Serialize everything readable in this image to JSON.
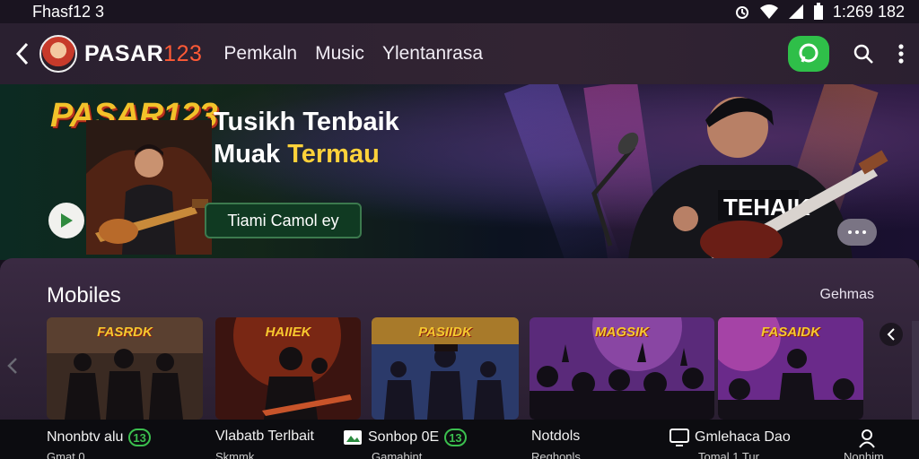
{
  "status_bar": {
    "left_text": "Fhasf12 3",
    "time": "1:269 182"
  },
  "app_bar": {
    "brand_text": "PASAR",
    "brand_number": "123",
    "nav": [
      "Pemkaln",
      "Music",
      "Ylentanrasa"
    ]
  },
  "hero": {
    "logo_text": "PASAR123",
    "heading_line1": "Tusikh Tenbaik",
    "heading_line2_plain": "Muak ",
    "heading_line2_accent": "Termau",
    "cta_label": "Tiami Camol ey",
    "shirt_text": "TEHAIK"
  },
  "section": {
    "title": "Mobiles",
    "see_all": "Gehmas",
    "cards": [
      {
        "label": "FASRDK",
        "bg": "#3a2a22"
      },
      {
        "label": "HAIIEK",
        "bg": "#3b1410"
      },
      {
        "label": "PASIIDK",
        "bg": "#2b3a6a"
      },
      {
        "label": "MAGSIK",
        "bg": "#5a2a7a"
      },
      {
        "label": "FASAIDK",
        "bg": "#6a2a8a"
      }
    ]
  },
  "bottom_nav": {
    "items": [
      {
        "label": "Nnonbtv alu",
        "badge": "13",
        "sub": "Gmat 0"
      },
      {
        "label": "Vlabatb Terlbait",
        "sub": "Skmmk"
      },
      {
        "label": "Sonbop 0E",
        "badge": "13",
        "sub": "Gamabint"
      },
      {
        "label": "Notdols",
        "sub": "Reghonls"
      },
      {
        "label": "Gmlehaca Dao",
        "sub": "Tomal 1 Tur"
      },
      {
        "label": "",
        "sub": "Nonhim"
      }
    ]
  },
  "colors": {
    "accent_green": "#2fbf49",
    "brand_orange": "#ff5a36",
    "hero_yellow": "#ffd23a"
  },
  "icons": [
    "back-chevron-icon",
    "whatsapp-icon",
    "search-icon",
    "more-vert-icon",
    "play-icon",
    "user-icon",
    "tv-icon",
    "image-icon",
    "alarm-icon",
    "wifi-icon",
    "signal-icon",
    "battery-icon"
  ]
}
